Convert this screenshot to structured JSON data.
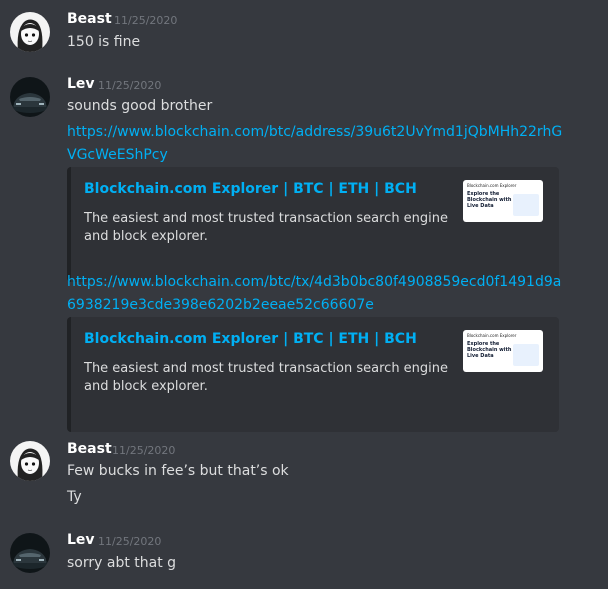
{
  "messages": [
    {
      "author": "Beast",
      "timestamp": "11/25/2020",
      "lines": [
        "150 is fine"
      ]
    },
    {
      "author": "Lev",
      "timestamp": "11/25/2020",
      "lines": [
        "sounds good brother"
      ],
      "links": [
        "https://www.blockchain.com/btc/address/39u6t2UvYmd1jQbMHh22rhGVGcWeEShPcy",
        "https://www.blockchain.com/btc/tx/4d3b0bc80f4908859ecd0f1491d9a6938219e3cde398e6202b2eeae52c66607e"
      ],
      "embeds": [
        {
          "title": "Blockchain.com Explorer | BTC | ETH | BCH",
          "description": "The easiest and most trusted transaction search engine and block explorer.",
          "thumb_brand": "Blockchain.com Explorer",
          "thumb_heading": "Explore the Blockchain with Live Data"
        },
        {
          "title": "Blockchain.com Explorer | BTC | ETH | BCH",
          "description": "The easiest and most trusted transaction search engine and block explorer.",
          "thumb_brand": "Blockchain.com Explorer",
          "thumb_heading": "Explore the Blockchain with Live Data"
        }
      ]
    },
    {
      "author": "Beast",
      "timestamp": "11/25/2020",
      "lines": [
        "Few bucks in fee’s but that’s ok",
        "Ty"
      ]
    },
    {
      "author": "Lev",
      "timestamp": "11/25/2020",
      "lines": [
        "sorry abt that g"
      ]
    }
  ],
  "colors": {
    "background": "#36393f",
    "link": "#00b0f4",
    "embed_bg": "#2f3136",
    "timestamp": "#72767d"
  }
}
